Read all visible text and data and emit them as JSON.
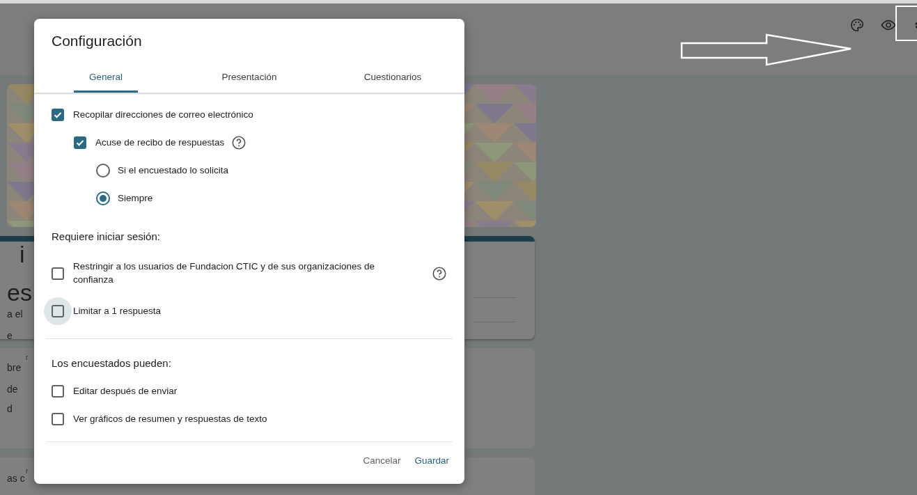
{
  "background": {
    "title_card_fragments": [
      {
        "text": "i",
        "kind": "large"
      },
      {
        "text": "es",
        "kind": "large"
      },
      {
        "text": "a el",
        "kind": "small"
      },
      {
        "text": "e",
        "kind": "small"
      }
    ],
    "question_card_fragments": [
      {
        "text": "r",
        "kind": "tiny"
      },
      {
        "text": "bre",
        "kind": "small"
      },
      {
        "text": "de",
        "kind": "small"
      },
      {
        "text": "d",
        "kind": "small"
      }
    ],
    "last_card_fragments": [
      {
        "text": "r",
        "kind": "tiny"
      },
      {
        "text": "as c",
        "kind": "small"
      }
    ]
  },
  "dialog": {
    "title": "Configuración",
    "tabs": [
      {
        "label": "General",
        "selected": true
      },
      {
        "label": "Presentación",
        "selected": false
      },
      {
        "label": "Cuestionarios",
        "selected": false
      }
    ],
    "sections": [
      {
        "items": [
          {
            "kind": "checkbox",
            "label": "Recopilar direcciones de correo electrónico",
            "checked": true,
            "children": [
              {
                "kind": "checkbox",
                "label": "Acuse de recibo de respuestas",
                "checked": true,
                "help": true,
                "children": [
                  {
                    "kind": "radio",
                    "label": "Si el encuestado lo solicita",
                    "selected": false
                  },
                  {
                    "kind": "radio",
                    "label": "Siempre",
                    "selected": true
                  }
                ]
              }
            ]
          }
        ]
      },
      {
        "heading": "Requiere iniciar sesión:",
        "items": [
          {
            "kind": "checkbox",
            "label": "Restringir a los usuarios de Fundacion CTIC y de sus organizaciones de confianza",
            "checked": false,
            "help": true
          },
          {
            "kind": "checkbox",
            "label": "Limitar a 1 respuesta",
            "checked": false,
            "focused": true
          }
        ]
      },
      {
        "divided": true,
        "heading": "Los encuestados pueden:",
        "items": [
          {
            "kind": "checkbox",
            "label": "Editar después de enviar",
            "checked": false
          },
          {
            "kind": "checkbox",
            "label": "Ver gráficos de resumen y respuestas de texto",
            "checked": false
          }
        ]
      }
    ],
    "buttons": [
      {
        "label": "Cancelar",
        "kind": "secondary"
      },
      {
        "label": "Guardar",
        "kind": "primary"
      }
    ]
  }
}
